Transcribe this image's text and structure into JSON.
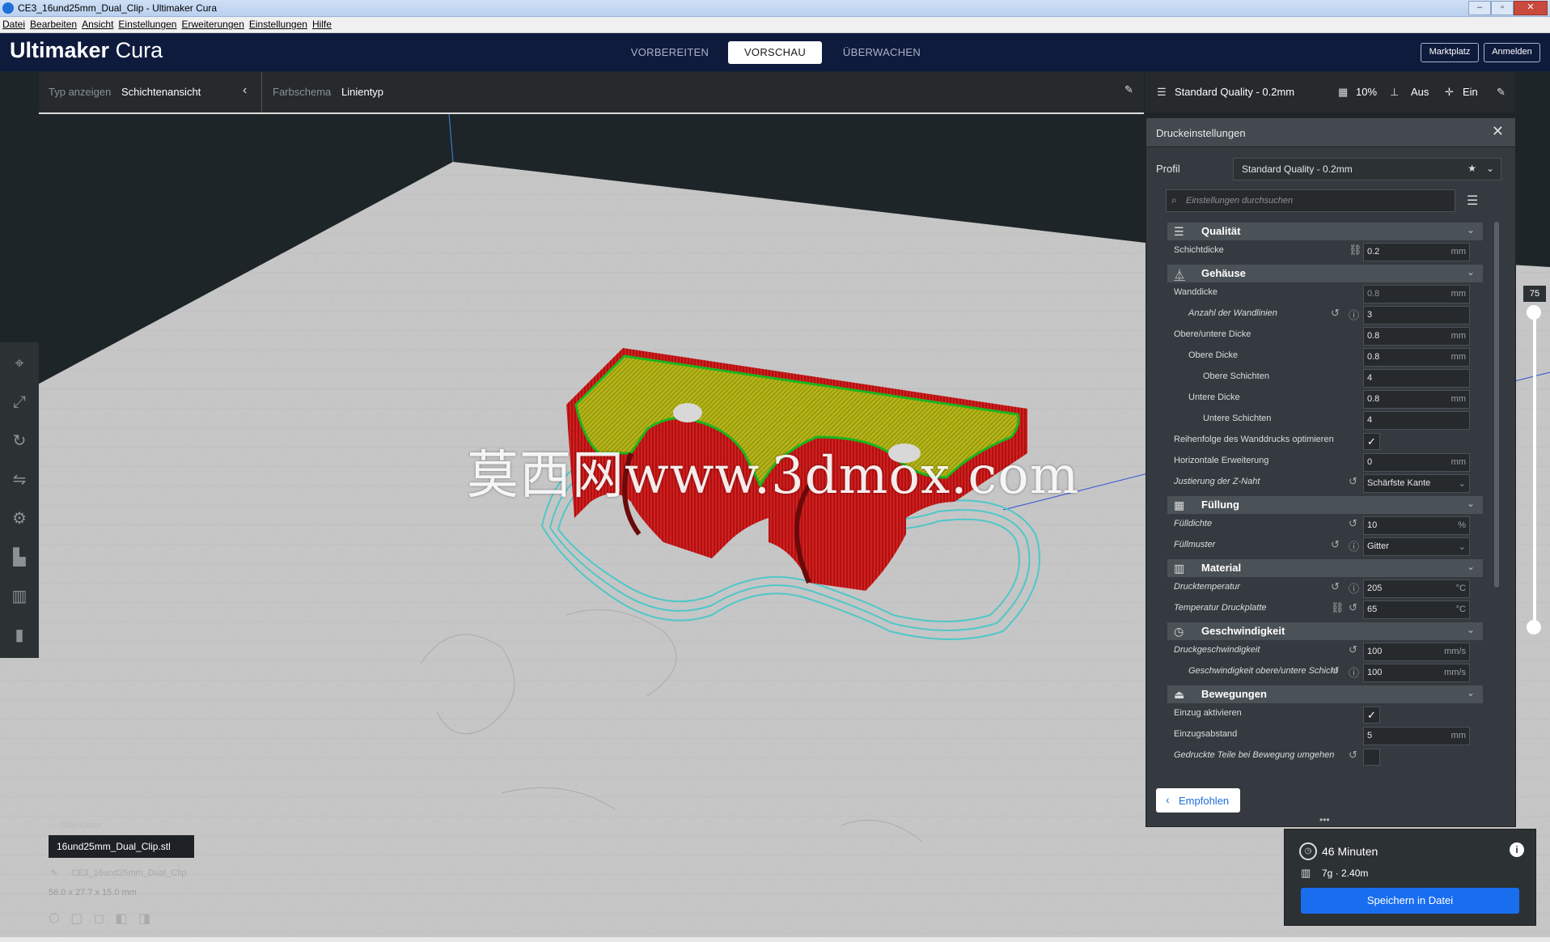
{
  "window": {
    "title": "CE3_16und25mm_Dual_Clip - Ultimaker Cura"
  },
  "menu": {
    "items": [
      "Datei",
      "Bearbeiten",
      "Ansicht",
      "Einstellungen",
      "Erweiterungen",
      "Einstellungen",
      "Hilfe"
    ]
  },
  "header": {
    "logo_bold": "Ultimaker",
    "logo_light": " Cura",
    "tabs": [
      "VORBEREITEN",
      "VORSCHAU",
      "ÜBERWACHEN"
    ],
    "active_tab": "VORSCHAU",
    "marketplace": "Marktplatz",
    "signin": "Anmelden"
  },
  "viewbar": {
    "type_label": "Typ anzeigen",
    "type_value": "Schichtenansicht",
    "scheme_label": "Farbschema",
    "scheme_value": "Linientyp"
  },
  "qualitybar": {
    "profile": "Standard Quality - 0.2mm",
    "infill": "10%",
    "support": "Aus",
    "adhesion": "Ein"
  },
  "panel": {
    "title": "Druckeinstellungen",
    "profile_label": "Profil",
    "profile_value": "Standard Quality - 0.2mm",
    "search_placeholder": "Einstellungen durchsuchen",
    "recommended": "Empfohlen"
  },
  "settings": {
    "quality": "Qualität",
    "layer_height": {
      "label": "Schichtdicke",
      "value": "0.2",
      "unit": "mm"
    },
    "shell": "Gehäuse",
    "wall_thickness": {
      "label": "Wanddicke",
      "value": "0.8",
      "unit": "mm"
    },
    "wall_lines": {
      "label": "Anzahl der Wandlinien",
      "value": "3"
    },
    "top_bottom": {
      "label": "Obere/untere Dicke",
      "value": "0.8",
      "unit": "mm"
    },
    "top_thickness": {
      "label": "Obere Dicke",
      "value": "0.8",
      "unit": "mm"
    },
    "top_layers": {
      "label": "Obere Schichten",
      "value": "4"
    },
    "bottom_thickness": {
      "label": "Untere Dicke",
      "value": "0.8",
      "unit": "mm"
    },
    "bottom_layers": {
      "label": "Untere Schichten",
      "value": "4"
    },
    "optimize_wall": {
      "label": "Reihenfolge des Wanddrucks optimieren"
    },
    "horizontal_exp": {
      "label": "Horizontale Erweiterung",
      "value": "0",
      "unit": "mm"
    },
    "z_seam": {
      "label": "Justierung der Z-Naht",
      "value": "Schärfste Kante"
    },
    "infill": "Füllung",
    "infill_density": {
      "label": "Fülldichte",
      "value": "10",
      "unit": "%"
    },
    "infill_pattern": {
      "label": "Füllmuster",
      "value": "Gitter"
    },
    "material": "Material",
    "print_temp": {
      "label": "Drucktemperatur",
      "value": "205",
      "unit": "°C"
    },
    "bed_temp": {
      "label": "Temperatur Druckplatte",
      "value": "65",
      "unit": "°C"
    },
    "speed": "Geschwindigkeit",
    "print_speed": {
      "label": "Druckgeschwindigkeit",
      "value": "100",
      "unit": "mm/s"
    },
    "topbottom_speed": {
      "label": "Geschwindigkeit obere/untere Schicht",
      "value": "100",
      "unit": "mm/s"
    },
    "travel": "Bewegungen",
    "retraction": {
      "label": "Einzug aktivieren"
    },
    "retraction_dist": {
      "label": "Einzugsabstand",
      "value": "5",
      "unit": "mm"
    },
    "avoid_parts": {
      "label": "Gedruckte Teile bei Bewegung umgehen"
    }
  },
  "layer_slider": {
    "value": "75"
  },
  "print_info": {
    "time": "46 Minuten",
    "material": "7g · 2.40m",
    "save": "Speichern in Datei"
  },
  "objects": {
    "header": "Objektliste",
    "file": "16und25mm_Dual_Clip.stl",
    "name": "CE3_16und25mm_Dual_Clip",
    "dims": "56.0 x 27.7 x 15.0 mm"
  },
  "watermark": "莫西网www.3dmox.com",
  "colors": {
    "header_bg": "#0f1b3d",
    "accent": "#196ef0",
    "wall_outer": "#c81414",
    "skin": "#c8c81e",
    "skirt": "#3cc8c8"
  }
}
